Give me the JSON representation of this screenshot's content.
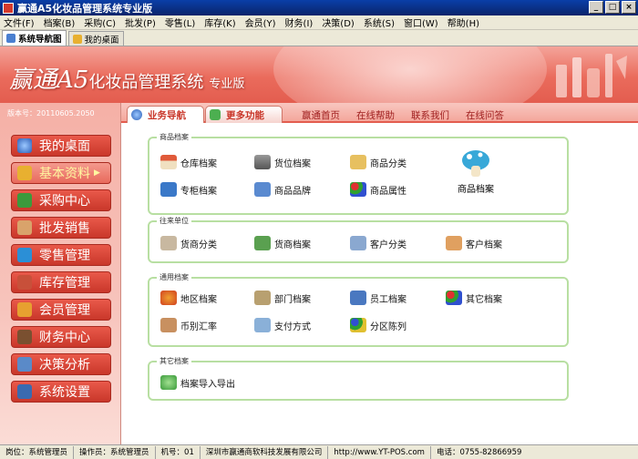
{
  "window": {
    "title": "赢通A5化妆品管理系统专业版"
  },
  "menu": [
    "文件(F)",
    "档案(B)",
    "采购(C)",
    "批发(P)",
    "零售(L)",
    "库存(K)",
    "会员(Y)",
    "财务(I)",
    "决策(D)",
    "系统(S)",
    "窗口(W)",
    "帮助(H)"
  ],
  "tabs": [
    "系统导航图",
    "我的桌面"
  ],
  "banner": {
    "brand": "赢通",
    "model": "A5",
    "product": "化妆品管理系统",
    "edition": "专业版"
  },
  "version": "版本号：20110605.2050",
  "sidebar": {
    "items": [
      "我的桌面",
      "基本资料",
      "采购中心",
      "批发销售",
      "零售管理",
      "库存管理",
      "会员管理",
      "财务中心",
      "决策分析",
      "系统设置"
    ],
    "active": "基本资料"
  },
  "top_tabs": [
    "业务导航",
    "更多功能"
  ],
  "top_links": [
    "赢通首页",
    "在线帮助",
    "联系我们",
    "在线问答"
  ],
  "groups": {
    "goods": {
      "title": "商品档案",
      "items": [
        "仓库档案",
        "货位档案",
        "商品分类",
        "专柜档案",
        "商品品牌",
        "商品属性"
      ],
      "big": "商品档案"
    },
    "partners": {
      "title": "往来单位",
      "items": [
        "货商分类",
        "货商档案",
        "客户分类",
        "客户档案"
      ]
    },
    "general": {
      "title": "通用档案",
      "items": [
        "地区档案",
        "部门档案",
        "员工档案",
        "其它档案",
        "币别汇率",
        "支付方式",
        "分区陈列"
      ]
    },
    "other": {
      "title": "其它档案",
      "items": [
        "档案导入导出"
      ]
    }
  },
  "status": {
    "position": "岗位：系统管理员",
    "operator": "操作员：系统管理员",
    "machine": "机号：01",
    "company": "深圳市赢通商软科技发展有限公司",
    "url": "http://www.YT-POS.com",
    "phone": "电话：0755-82866959"
  },
  "colors": {
    "accent": "#e35d4f",
    "group_border": "#b8dfa2",
    "link": "#a02020"
  }
}
